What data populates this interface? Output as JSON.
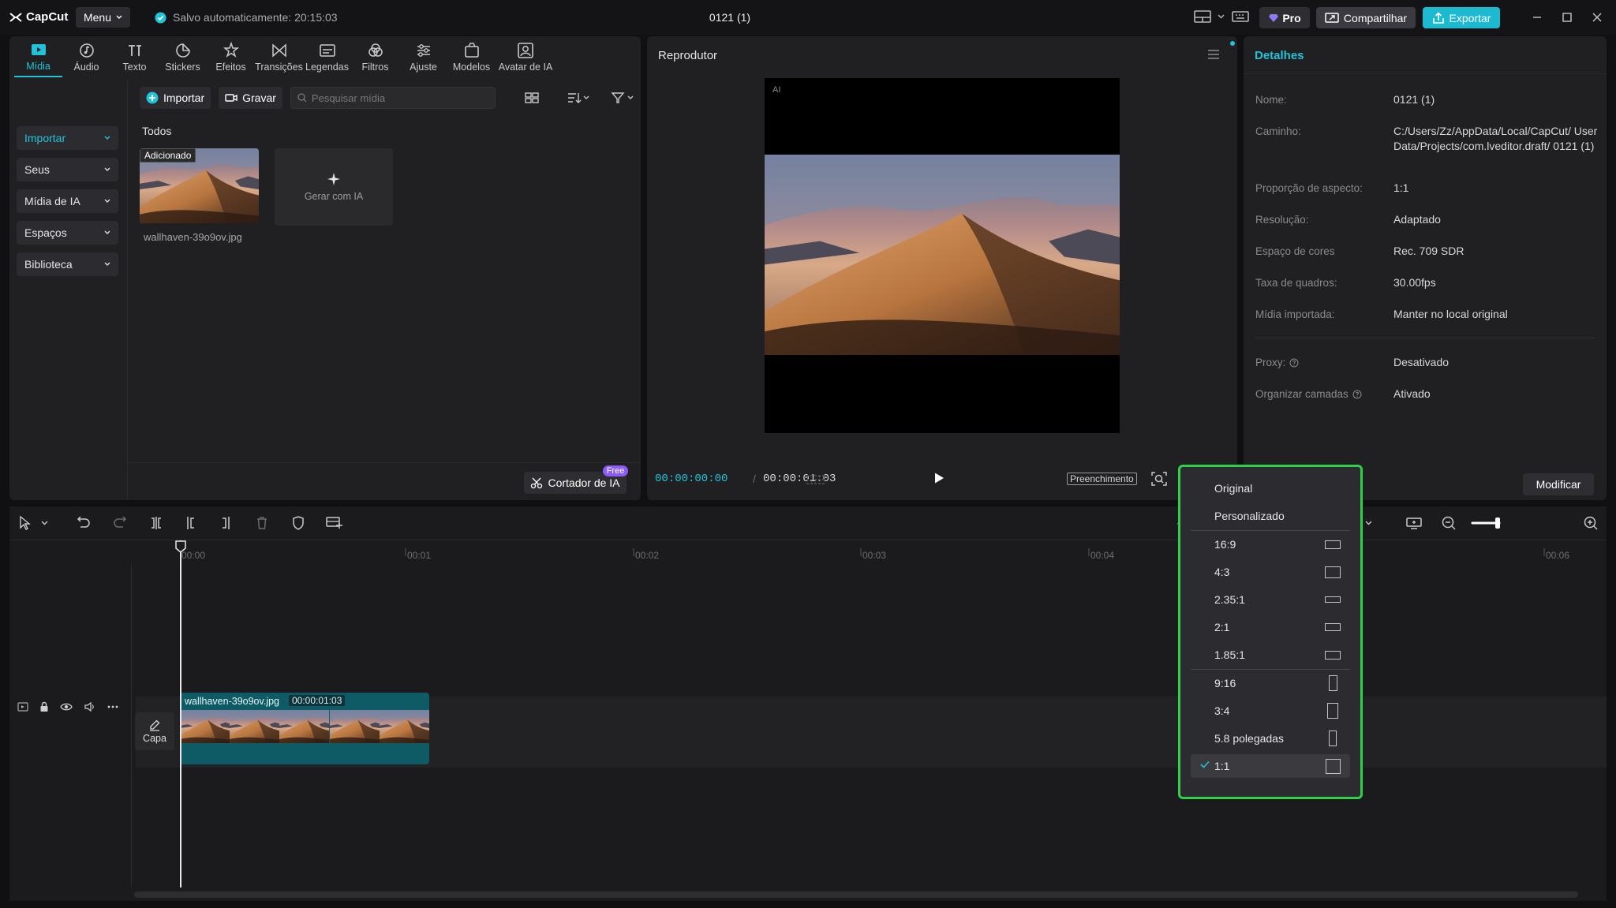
{
  "app": {
    "logo_text": "CapCut",
    "menu_label": "Menu",
    "autosave_text": "Salvo automaticamente: 20:15:03",
    "project_title": "0121 (1)",
    "pro_label": "Pro",
    "share_label": "Compartilhar",
    "export_label": "Exportar"
  },
  "tool_tabs": [
    {
      "label": "Mídia",
      "icon": "media-icon"
    },
    {
      "label": "Áudio",
      "icon": "audio-icon"
    },
    {
      "label": "Texto",
      "icon": "text-icon"
    },
    {
      "label": "Stickers",
      "icon": "sticker-icon"
    },
    {
      "label": "Efeitos",
      "icon": "effects-icon"
    },
    {
      "label": "Transições",
      "icon": "transition-icon"
    },
    {
      "label": "Legendas",
      "icon": "captions-icon"
    },
    {
      "label": "Filtros",
      "icon": "filter-icon"
    },
    {
      "label": "Ajuste",
      "icon": "adjust-icon"
    },
    {
      "label": "Modelos",
      "icon": "templates-icon"
    },
    {
      "label": "Avatar de IA",
      "icon": "ai-avatar-icon"
    }
  ],
  "left_nav": [
    {
      "label": "Importar"
    },
    {
      "label": "Seus"
    },
    {
      "label": "Mídia de IA"
    },
    {
      "label": "Espaços"
    },
    {
      "label": "Biblioteca"
    }
  ],
  "media": {
    "import_label": "Importar",
    "record_label": "Gravar",
    "search_placeholder": "Pesquisar mídia",
    "filter_all": "Todos",
    "added_badge": "Adicionado",
    "file_name": "wallhaven-39o9ov.jpg",
    "generate_ai_label": "Gerar com IA",
    "ai_cutter_label": "Cortador de IA",
    "free_tag": "Free"
  },
  "player": {
    "title": "Reprodutor",
    "canvas_label": "AI",
    "current_time": "00:00:00:00",
    "time_separator": "/",
    "total_time": "00:00:01:03",
    "fill_label": "Preenchimento"
  },
  "details": {
    "title": "Detalhes",
    "rows": [
      {
        "label": "Nome:",
        "value": "0121 (1)"
      },
      {
        "label": "Caminho:",
        "value": "C:/Users/Zz/AppData/Local/CapCut/ User Data/Projects/com.lveditor.draft/ 0121 (1)"
      },
      {
        "label": "Proporção de aspecto:",
        "value": "1:1"
      },
      {
        "label": "Resolução:",
        "value": "Adaptado"
      },
      {
        "label": "Espaço de cores",
        "value": "Rec. 709 SDR"
      },
      {
        "label": "Taxa de quadros:",
        "value": "30.00fps"
      },
      {
        "label": "Mídia importada:",
        "value": "Manter no local original"
      },
      {
        "label": "Proxy:",
        "value": "Desativado"
      },
      {
        "label": "Organizar camadas",
        "value": "Ativado"
      }
    ],
    "modify_label": "Modificar"
  },
  "timeline": {
    "ruler": [
      "00:00",
      "00:01",
      "00:02",
      "00:03",
      "00:04",
      "00:06"
    ],
    "clip_name": "wallhaven-39o9ov.jpg",
    "clip_duration": "00:00:01:03",
    "cover_label": "Capa"
  },
  "ratio_menu": {
    "items": [
      {
        "label": "Original"
      },
      {
        "label": "Personalizado"
      },
      {
        "label": "16:9"
      },
      {
        "label": "4:3"
      },
      {
        "label": "2.35:1"
      },
      {
        "label": "2:1"
      },
      {
        "label": "1.85:1"
      },
      {
        "label": "9:16"
      },
      {
        "label": "3:4"
      },
      {
        "label": "5.8 polegadas"
      },
      {
        "label": "1:1"
      }
    ],
    "selected": "1:1",
    "highlight_color": "#2ed24a"
  },
  "colors": {
    "accent": "#22c3d8",
    "export": "#1cbad0",
    "clip": "#0e5b66",
    "free_tag": "#8b5cf6"
  }
}
